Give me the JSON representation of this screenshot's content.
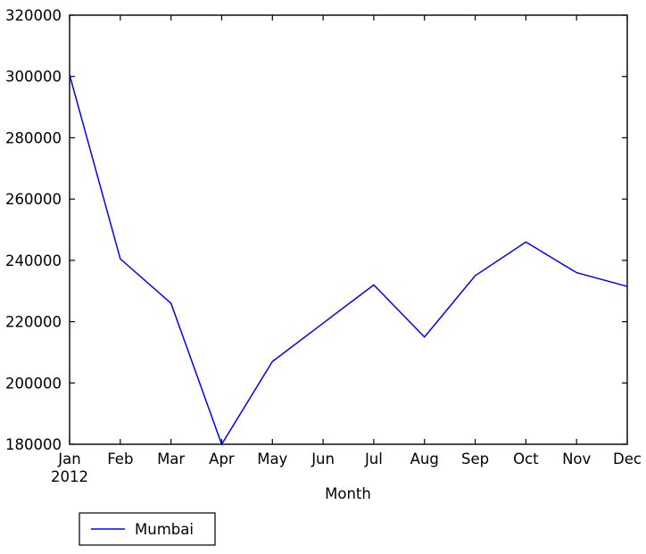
{
  "chart_data": {
    "type": "line",
    "title": "",
    "xlabel": "Month",
    "ylabel": "",
    "categories": [
      "Jan",
      "Feb",
      "Mar",
      "Apr",
      "May",
      "Jun",
      "Jul",
      "Aug",
      "Sep",
      "Oct",
      "Nov",
      "Dec"
    ],
    "x_sublabel": "2012",
    "series": [
      {
        "name": "Mumbai",
        "color": "#0000ff",
        "values": [
          300500,
          240500,
          226000,
          180000,
          207000,
          219500,
          232000,
          215000,
          235000,
          246000,
          236000,
          231500
        ]
      }
    ],
    "ylim": [
      180000,
      320000
    ],
    "yticks": [
      "180000",
      "200000",
      "220000",
      "240000",
      "260000",
      "280000",
      "300000",
      "320000"
    ],
    "ytick_values": [
      180000,
      200000,
      220000,
      240000,
      260000,
      280000,
      300000,
      320000
    ],
    "xtick_labels": [
      "Jan",
      "Feb",
      "Mar",
      "Apr",
      "May",
      "Jun",
      "Jul",
      "Aug",
      "Sep",
      "Oct",
      "Nov",
      "Dec"
    ],
    "grid": false,
    "legend": {
      "position": "lower-left-outside",
      "entries": [
        "Mumbai"
      ]
    }
  },
  "axis": {
    "x_title": "Month",
    "x_sub": "2012"
  },
  "legend": {
    "mumbai_label": "Mumbai"
  }
}
